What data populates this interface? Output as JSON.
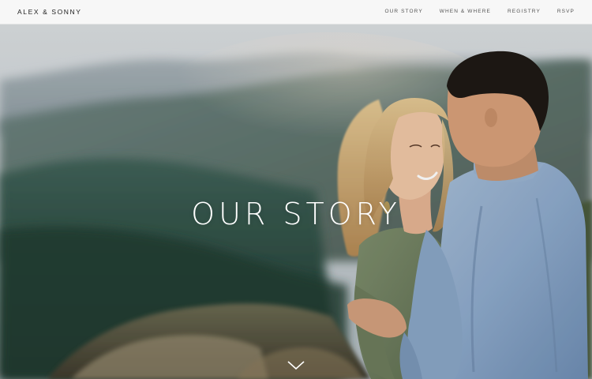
{
  "site": {
    "brand": "ALEX & SONNY"
  },
  "nav": {
    "items": [
      {
        "label": "OUR STORY"
      },
      {
        "label": "WHEN & WHERE"
      },
      {
        "label": "REGISTRY"
      },
      {
        "label": "RSVP"
      }
    ]
  },
  "hero": {
    "title": "OUR STORY",
    "scroll_icon": "chevron-down-icon",
    "image_description_icon": "couple-photo"
  },
  "colors": {
    "nav_background": "#f7f7f7",
    "title_color": "#ffffff",
    "brand_color": "#222222"
  }
}
